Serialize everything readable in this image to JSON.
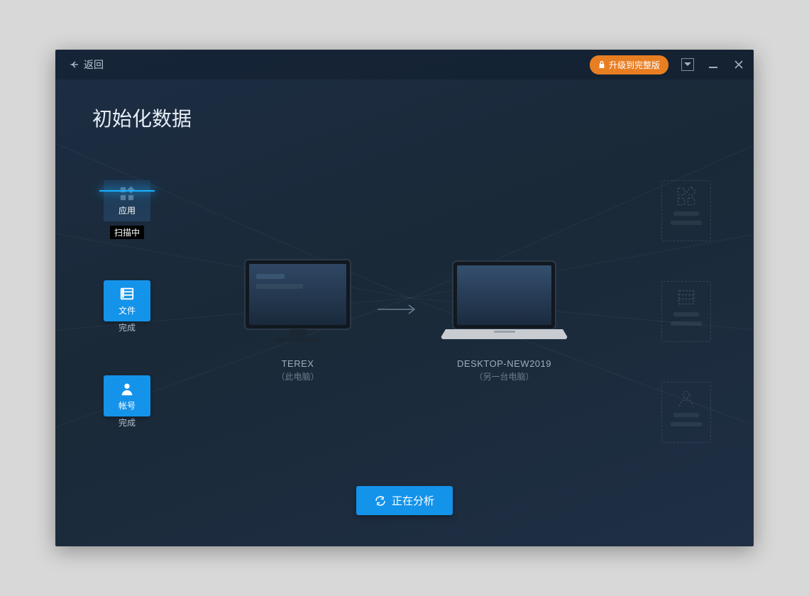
{
  "titlebar": {
    "back_label": "返回",
    "upgrade_label": "升级到完整版"
  },
  "page": {
    "title": "初始化数据"
  },
  "tiles": {
    "apps": {
      "label": "应用",
      "status": "扫描中"
    },
    "files": {
      "label": "文件",
      "status": "完成"
    },
    "accounts": {
      "label": "帐号",
      "status": "完成"
    }
  },
  "center": {
    "source_name": "TEREX",
    "source_sub": "（此电脑）",
    "target_name": "DESKTOP-NEW2019",
    "target_sub": "（另一台电脑）"
  },
  "action": {
    "label": "正在分析"
  }
}
